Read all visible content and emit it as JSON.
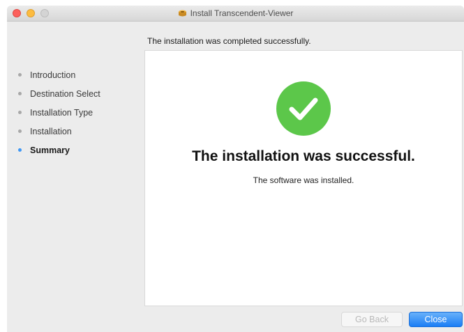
{
  "window": {
    "title": "Install Transcendent-Viewer",
    "icon": "package-icon"
  },
  "header": {
    "status_text": "The installation was completed successfully."
  },
  "sidebar": {
    "items": [
      {
        "label": "Introduction",
        "active": false
      },
      {
        "label": "Destination Select",
        "active": false
      },
      {
        "label": "Installation Type",
        "active": false
      },
      {
        "label": "Installation",
        "active": false
      },
      {
        "label": "Summary",
        "active": true
      }
    ]
  },
  "main": {
    "success_icon": "checkmark-circle-icon",
    "headline": "The installation was successful.",
    "subtext": "The software was installed."
  },
  "buttons": {
    "back_label": "Go Back",
    "back_enabled": false,
    "close_label": "Close"
  },
  "colors": {
    "success_green": "#5cc74a",
    "accent_blue": "#3d97f5",
    "close_red": "#fc605c",
    "minimize_yellow": "#fdbc40"
  }
}
